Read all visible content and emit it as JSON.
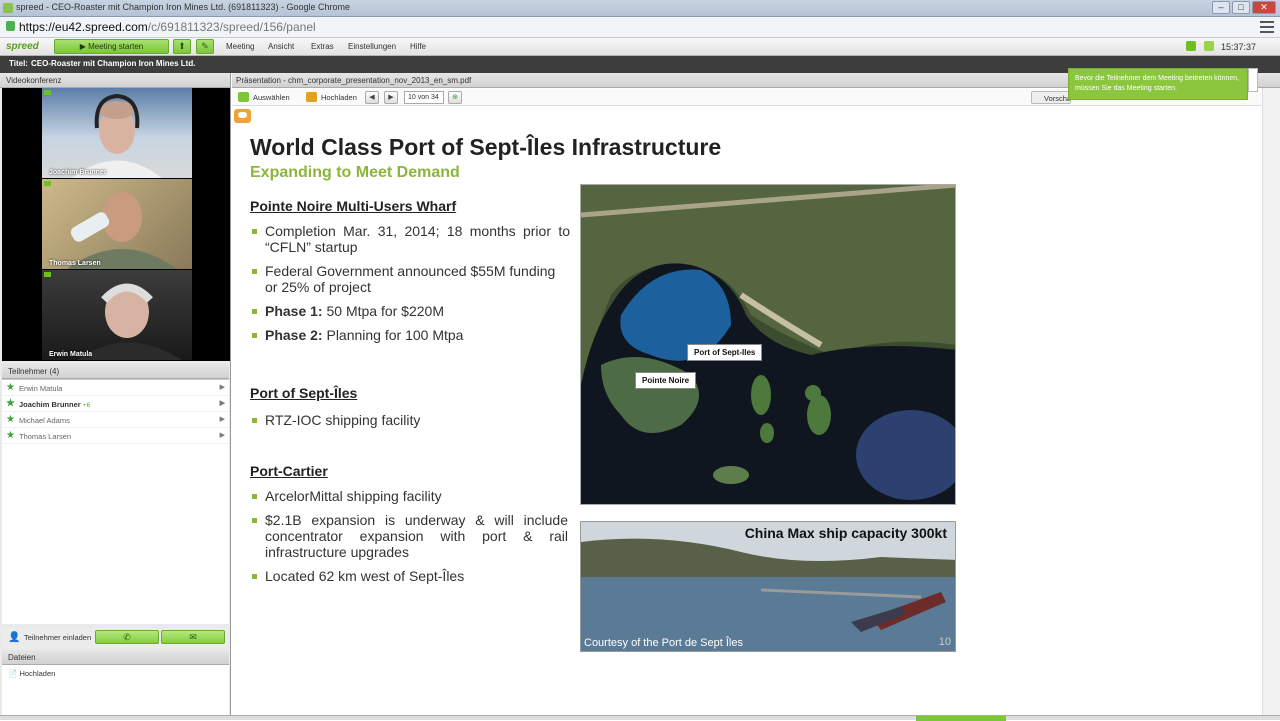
{
  "browser": {
    "window_title": "spreed - CEO-Roaster mit Champion Iron Mines Ltd. (691811323) - Google Chrome",
    "url_host": "https://eu42.spreed.com",
    "url_path": "/c/691811323/spreed/156/panel"
  },
  "menubar": {
    "logo": "spreed",
    "meeting_start": "Meeting starten",
    "items": [
      "Meeting",
      "Ansicht",
      "Extras",
      "Einstellungen",
      "Hilfe"
    ],
    "clock": "15:37:37"
  },
  "titlestrip": {
    "label": "Titel:",
    "value": "CEO-Roaster mit Champion Iron Mines Ltd."
  },
  "left": {
    "video_header": "Videokonferenz",
    "videos": [
      "Joachim Brunner",
      "Thomas Larsen",
      "Erwin Matula"
    ],
    "participants_header": "Teilnehmer (4)",
    "participants": [
      {
        "name": "Erwin Matula",
        "tag": ""
      },
      {
        "name": "Joachim Brunner",
        "tag": "+6"
      },
      {
        "name": "Michael Adams",
        "tag": ""
      },
      {
        "name": "Thomas Larsen",
        "tag": ""
      }
    ],
    "invite_label": "Teilnehmer einladen",
    "files_header": "Dateien",
    "files_upload": "Hochladen"
  },
  "presentation": {
    "header": "Präsentation - chm_corporate_presentation_nov_2013_en_sm.pdf",
    "select_label": "Auswählen",
    "upload_label": "Hochladen",
    "page_indicator": "10 von 34",
    "preview_label": "Vorschau",
    "tooltip": "Bevor die Teilnehmer dem Meeting beitreten können, müssen Sie das Meeting starten."
  },
  "slide": {
    "title": "World Class Port of Sept-Îles Infrastructure",
    "subtitle": "Expanding to Meet Demand",
    "section1": "Pointe Noire Multi-Users Wharf",
    "section1_bullets": [
      "Completion Mar. 31, 2014; 18 months prior to “CFLN” startup",
      "Federal Government announced $55M funding or 25% of project"
    ],
    "phase1_label": "Phase 1:",
    "phase1_text": " 50 Mtpa for $220M",
    "phase2_label": "Phase 2:",
    "phase2_text": " Planning for 100 Mtpa",
    "section2": "Port of Sept-Îles",
    "section2_bullets": [
      "RTZ-IOC shipping facility"
    ],
    "section3": "Port-Cartier",
    "section3_bullets": [
      "ArcelorMittal shipping facility",
      "$2.1B expansion is underway & will include concentrator expansion with port & rail infrastructure upgrades",
      "Located 62 km west of Sept-Îles"
    ],
    "map_label1": "Port of Sept-Iles",
    "map_label2": "Pointe Noire",
    "photo_caption": "China Max ship capacity 300kt",
    "photo_credit": "Courtesy of the Port de Sept Îles",
    "page_number": "10"
  },
  "colors": {
    "accent_green": "#8db53c",
    "button_green": "#7cc63a",
    "tooltip_green": "#8cc63f"
  }
}
